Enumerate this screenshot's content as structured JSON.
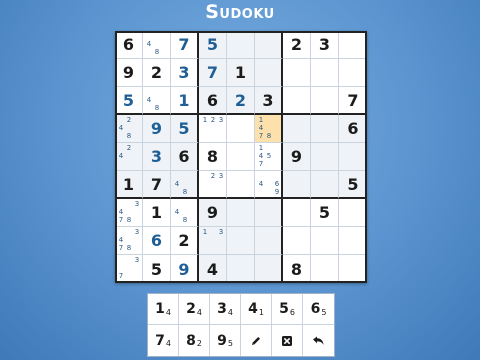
{
  "title": "Sudoku",
  "colors": {
    "given": "#1b1b1b",
    "user": "#1f5f96",
    "selected_bg": "#fde1ad",
    "box_shade": "#eff3f7"
  },
  "board": {
    "selected_cell": {
      "row": 3,
      "col": 5
    },
    "rows": [
      [
        {
          "v": "6",
          "k": "given"
        },
        {
          "n": [
            4,
            8
          ]
        },
        {
          "v": "7",
          "k": "user"
        },
        {
          "v": "5",
          "k": "user"
        },
        {},
        {},
        {
          "v": "2",
          "k": "given"
        },
        {
          "v": "3",
          "k": "given"
        },
        {}
      ],
      [
        {
          "v": "9",
          "k": "given"
        },
        {
          "v": "2",
          "k": "given"
        },
        {
          "v": "3",
          "k": "user"
        },
        {
          "v": "7",
          "k": "user"
        },
        {
          "v": "1",
          "k": "given"
        },
        {},
        {},
        {},
        {}
      ],
      [
        {
          "v": "5",
          "k": "user"
        },
        {
          "n": [
            4,
            8
          ]
        },
        {
          "v": "1",
          "k": "user"
        },
        {
          "v": "6",
          "k": "given"
        },
        {
          "v": "2",
          "k": "user"
        },
        {
          "v": "3",
          "k": "given"
        },
        {},
        {},
        {
          "v": "7",
          "k": "given"
        }
      ],
      [
        {
          "n": [
            2,
            4,
            8
          ]
        },
        {
          "v": "9",
          "k": "user"
        },
        {
          "v": "5",
          "k": "user"
        },
        {
          "n": [
            1,
            2,
            3
          ]
        },
        {},
        {
          "n": [
            1,
            4,
            7,
            8
          ]
        },
        {},
        {},
        {
          "v": "6",
          "k": "given"
        }
      ],
      [
        {
          "n": [
            2,
            4
          ]
        },
        {
          "v": "3",
          "k": "user"
        },
        {
          "v": "6",
          "k": "given"
        },
        {
          "v": "8",
          "k": "given"
        },
        {},
        {
          "n": [
            1,
            4,
            5,
            7
          ]
        },
        {
          "v": "9",
          "k": "given"
        },
        {},
        {}
      ],
      [
        {
          "v": "1",
          "k": "given"
        },
        {
          "v": "7",
          "k": "given"
        },
        {
          "n": [
            4,
            8
          ]
        },
        {
          "n": [
            2,
            3
          ]
        },
        {},
        {
          "n": [
            4,
            6,
            9
          ]
        },
        {},
        {},
        {
          "v": "5",
          "k": "given"
        }
      ],
      [
        {
          "n": [
            3,
            4,
            7,
            8
          ]
        },
        {
          "v": "1",
          "k": "given"
        },
        {
          "n": [
            4,
            8
          ]
        },
        {
          "v": "9",
          "k": "given"
        },
        {},
        {},
        {},
        {
          "v": "5",
          "k": "given"
        },
        {}
      ],
      [
        {
          "n": [
            3,
            4,
            7,
            8
          ]
        },
        {
          "v": "6",
          "k": "user"
        },
        {
          "v": "2",
          "k": "given"
        },
        {
          "n": [
            1,
            3
          ]
        },
        {},
        {},
        {},
        {},
        {}
      ],
      [
        {
          "n": [
            3,
            7
          ]
        },
        {
          "v": "5",
          "k": "given"
        },
        {
          "v": "9",
          "k": "user"
        },
        {
          "v": "4",
          "k": "given"
        },
        {},
        {},
        {
          "v": "8",
          "k": "given"
        },
        {},
        {}
      ]
    ]
  },
  "keypad": {
    "digits": [
      {
        "digit": "1",
        "remaining": "4"
      },
      {
        "digit": "2",
        "remaining": "4"
      },
      {
        "digit": "3",
        "remaining": "4"
      },
      {
        "digit": "4",
        "remaining": "1"
      },
      {
        "digit": "5",
        "remaining": "6"
      },
      {
        "digit": "6",
        "remaining": "5"
      },
      {
        "digit": "7",
        "remaining": "4"
      },
      {
        "digit": "8",
        "remaining": "2"
      },
      {
        "digit": "9",
        "remaining": "5"
      }
    ],
    "tools": [
      {
        "name": "pencil-icon"
      },
      {
        "name": "erase-icon"
      },
      {
        "name": "undo-icon"
      }
    ]
  }
}
